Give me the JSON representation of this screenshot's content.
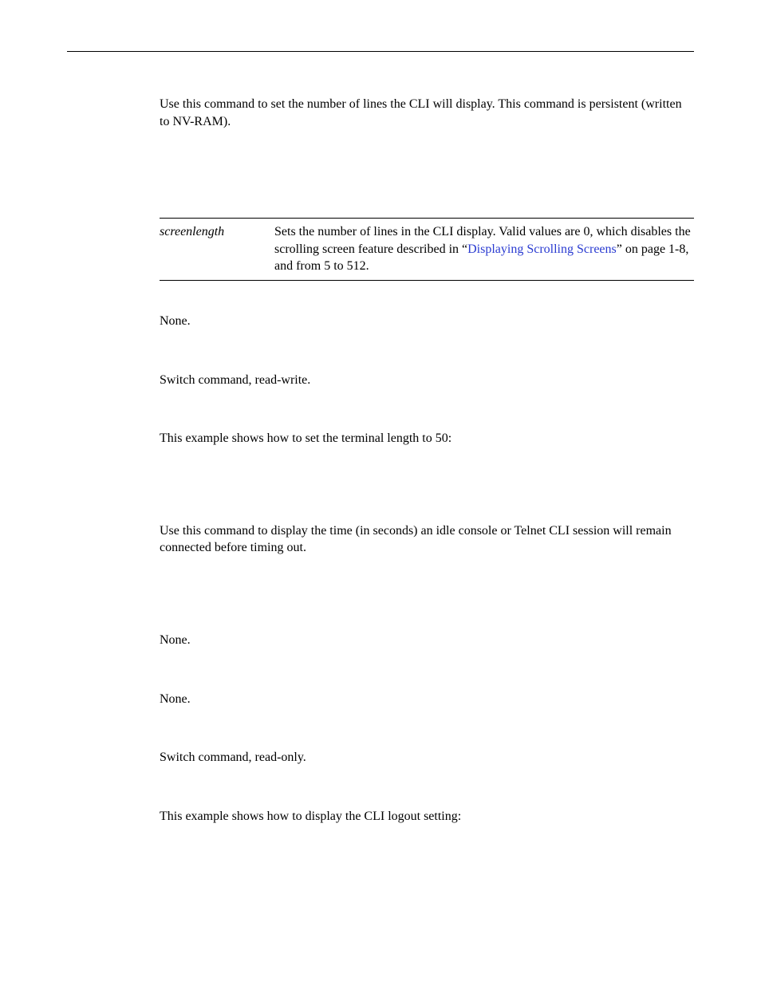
{
  "intro1": "Use this command to set the number of lines the CLI will display. This command is persistent (written to NV-RAM).",
  "param_table": {
    "name": "screenlength",
    "desc_before": "Sets the number of lines in the CLI display. Valid values are 0, which disables the scrolling screen feature described in “",
    "link_text": "Displaying Scrolling Screens",
    "desc_after": "” on page 1-8, and from 5 to 512."
  },
  "defaults1": "None.",
  "mode1": "Switch command, read-write.",
  "example1": "This example shows how to set the terminal length to 50:",
  "intro2": "Use this command to display the time (in seconds) an idle console or Telnet CLI session will remain connected before timing out.",
  "parameters2": "None.",
  "defaults2": "None.",
  "mode2": "Switch command, read-only.",
  "example2": "This example shows how to display the CLI logout setting:"
}
